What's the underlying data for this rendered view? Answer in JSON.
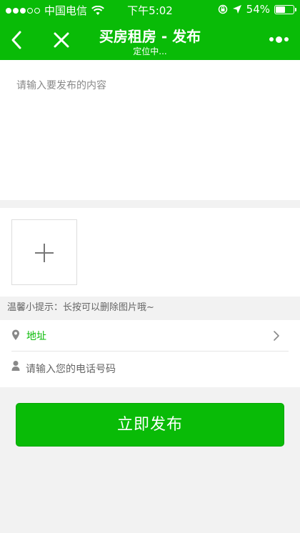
{
  "status_bar": {
    "carrier": "中国电信",
    "time": "下午5:02",
    "battery_percent": "54%",
    "battery_level": 0.54,
    "signal_bars_filled": 3,
    "signal_bars_total": 5
  },
  "nav": {
    "title": "买房租房 - 发布",
    "subtitle": "定位中...",
    "back_icon": "chevron-left-icon",
    "close_icon": "close-icon",
    "more_icon": "more-dots-icon"
  },
  "content": {
    "placeholder": "请输入要发布的内容"
  },
  "photos": {
    "add_icon": "plus-icon"
  },
  "hint": "温馨小提示：长按可以删除图片哦~",
  "form": {
    "address_label": "地址",
    "phone_placeholder": "请输入您的电话号码"
  },
  "publish_label": "立即发布",
  "colors": {
    "accent": "#09bb07",
    "background": "#f2f2f2"
  }
}
